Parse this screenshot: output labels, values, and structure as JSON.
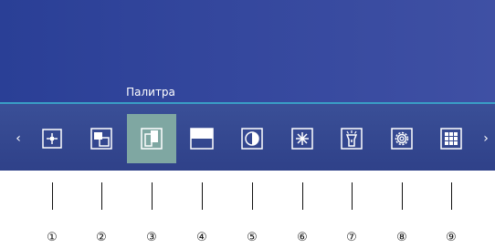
{
  "tooltip": "Палитра",
  "nav": {
    "prev_arrow": "‹",
    "next_arrow": "›"
  },
  "toolbar": {
    "selected_index": 3,
    "items": [
      {
        "icon": "crosshair-icon",
        "callout": "①"
      },
      {
        "icon": "overlap-windows-icon",
        "callout": "②"
      },
      {
        "icon": "palette-icon",
        "callout": "③"
      },
      {
        "icon": "split-screen-icon",
        "callout": "④"
      },
      {
        "icon": "contrast-icon",
        "callout": "⑤"
      },
      {
        "icon": "brightness-icon",
        "callout": "⑥"
      },
      {
        "icon": "flashlight-icon",
        "callout": "⑦"
      },
      {
        "icon": "settings-gear-icon",
        "callout": "⑧"
      },
      {
        "icon": "grid-apps-icon",
        "callout": "⑨"
      }
    ]
  },
  "colors": {
    "background": "#34479d",
    "highlight": "#7fa7a2",
    "accent_line": "#3a9ec6"
  }
}
